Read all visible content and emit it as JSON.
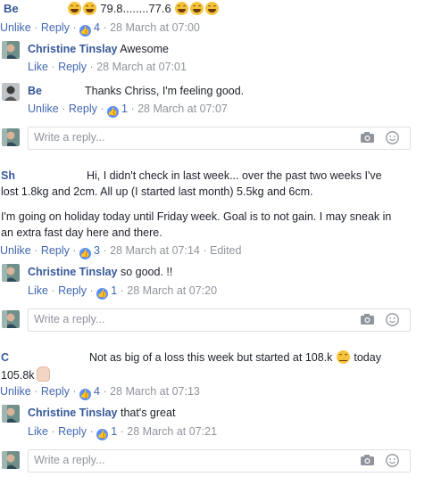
{
  "comments": [
    {
      "id": "c1",
      "author": "Be",
      "text_after_emoji": " 79.8........77.6 ",
      "actions": {
        "like": "Unlike",
        "reply": "Reply",
        "count": "4",
        "time": "28 March at 07:00"
      },
      "replies": [
        {
          "author": "Christine Tinslay",
          "text": " Awesome",
          "actions": {
            "like": "Like",
            "reply": "Reply",
            "count": "",
            "time": "28 March at 07:01"
          }
        },
        {
          "author": "Be",
          "text": "Thanks Chriss, I'm feeling good.",
          "actions": {
            "like": "Unlike",
            "reply": "Reply",
            "count": "1",
            "time": "28 March at 07:07"
          }
        }
      ],
      "reply_placeholder": "Write a reply..."
    },
    {
      "id": "c2",
      "author": "Sh",
      "lines": [
        "Hi, I didn't check in last week... over the past two weeks I've",
        "lost 1.8kg and 2cm. All up (I started last month) 5.5kg and 6cm.",
        "I'm going on holiday today until Friday week. Goal is to not gain. I may sneak in",
        "an extra fast day here and there."
      ],
      "actions": {
        "like": "Unlike",
        "reply": "Reply",
        "count": "3",
        "time": "28 March at 07:14",
        "edited": "Edited"
      },
      "replies": [
        {
          "author": "Christine Tinslay",
          "text": " so good. !!",
          "actions": {
            "like": "Like",
            "reply": "Reply",
            "count": "1",
            "time": "28 March at 07:20"
          }
        }
      ],
      "reply_placeholder": "Write a reply..."
    },
    {
      "id": "c3",
      "author": "C",
      "line1": "Not as big of a loss this week but started at 108.k",
      "line1_after": " today",
      "line2": "105.8k",
      "actions": {
        "like": "Unlike",
        "reply": "Reply",
        "count": "4",
        "time": "28 March at 07:13"
      },
      "replies": [
        {
          "author": "Christine Tinslay",
          "text": " that's great",
          "actions": {
            "like": "Like",
            "reply": "Reply",
            "count": "1",
            "time": "28 March at 07:21"
          }
        }
      ],
      "reply_placeholder": "Write a reply..."
    }
  ],
  "icons": {
    "like_badge": "thumbs-up-icon",
    "camera": "camera-icon",
    "emoji_picker": "smiley-icon",
    "reaction_emoji": "grinning-face-icon",
    "relieved_emoji": "relieved-face-icon",
    "hand_emoji": "raised-hand-icon"
  },
  "colors": {
    "author": "#365899",
    "link": "#4267b2",
    "meta": "#90949c",
    "like_badge": "#5890ff",
    "text": "#1d2129"
  }
}
